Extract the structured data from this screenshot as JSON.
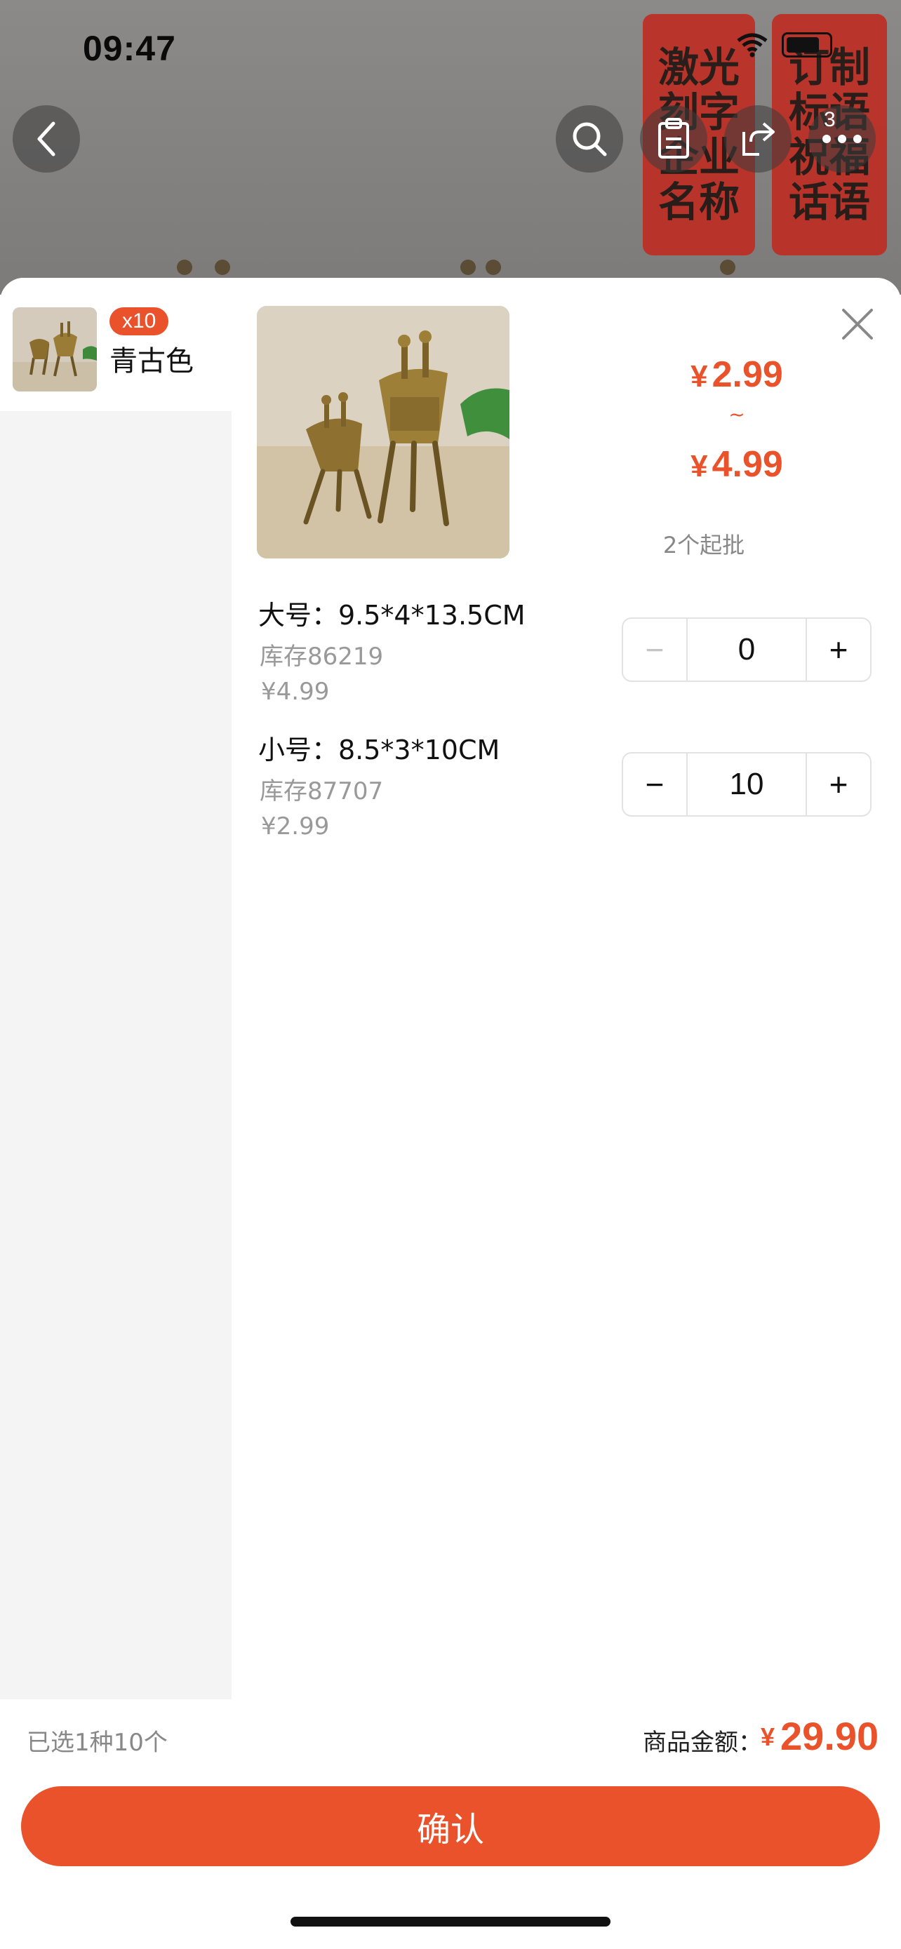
{
  "status_bar": {
    "time": "09:47"
  },
  "background": {
    "tiles": [
      "激光刻字企业名称",
      "订制标语祝福话语"
    ],
    "cart_count": "3",
    "icons": [
      "back-icon",
      "search-icon",
      "clipboard-icon",
      "share-icon",
      "more-icon"
    ]
  },
  "sheet": {
    "sidebar": {
      "items": [
        {
          "label": "青古色",
          "badge": "x10"
        }
      ]
    },
    "price": {
      "currency": "¥",
      "min": "2.99",
      "tilde": "~",
      "max": "4.99",
      "moq": "2个起批"
    },
    "skus": [
      {
        "name": "大号：9.5*4*13.5CM",
        "stock": "库存86219",
        "price": "¥4.99",
        "quantity": "0",
        "minus": "−",
        "plus": "+"
      },
      {
        "name": "小号：8.5*3*10CM",
        "stock": "库存87707",
        "price": "¥2.99",
        "quantity": "10",
        "minus": "−",
        "plus": "+"
      }
    ],
    "footer": {
      "selected": "已选1种10个",
      "amount_label": "商品金额：",
      "amount_currency": "¥",
      "amount": "29.90",
      "confirm_label": "确认"
    }
  },
  "colors": {
    "accent": "#e9522b",
    "sidebar_bg": "#f4f4f4",
    "muted_text": "#999999"
  }
}
